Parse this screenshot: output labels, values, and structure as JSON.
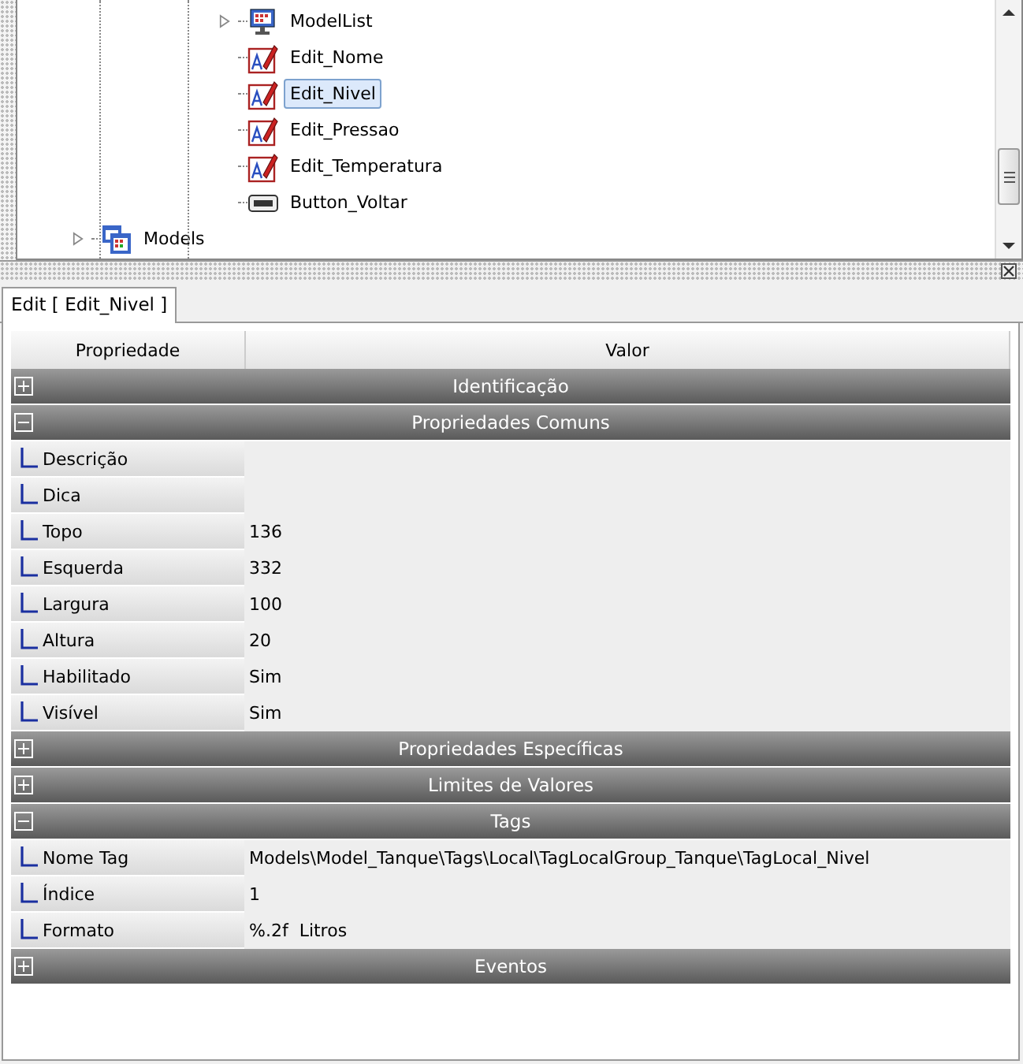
{
  "tree": {
    "items": [
      {
        "label": "ModelList",
        "kind": "list",
        "expandable": true,
        "selected": false
      },
      {
        "label": "Edit_Nome",
        "kind": "edit",
        "expandable": false,
        "selected": false
      },
      {
        "label": "Edit_Nivel",
        "kind": "edit",
        "expandable": false,
        "selected": true
      },
      {
        "label": "Edit_Pressao",
        "kind": "edit",
        "expandable": false,
        "selected": false
      },
      {
        "label": "Edit_Temperatura",
        "kind": "edit",
        "expandable": false,
        "selected": false
      },
      {
        "label": "Button_Voltar",
        "kind": "button",
        "expandable": false,
        "selected": false
      }
    ],
    "outer_items": [
      {
        "label": "Models",
        "kind": "models",
        "expandable": true,
        "selected": false
      }
    ]
  },
  "tab": {
    "label": "Edit [ Edit_Nivel ]"
  },
  "grid": {
    "columns": [
      "Propriedade",
      "Valor"
    ],
    "sections": [
      {
        "title": "Identificação",
        "expanded": false
      },
      {
        "title": "Propriedades Comuns",
        "expanded": true,
        "rows": [
          {
            "name": "Descrição",
            "value": ""
          },
          {
            "name": "Dica",
            "value": ""
          },
          {
            "name": "Topo",
            "value": "136"
          },
          {
            "name": "Esquerda",
            "value": "332"
          },
          {
            "name": "Largura",
            "value": "100"
          },
          {
            "name": "Altura",
            "value": "20"
          },
          {
            "name": "Habilitado",
            "value": "Sim"
          },
          {
            "name": "Visível",
            "value": "Sim"
          }
        ]
      },
      {
        "title": "Propriedades Específicas",
        "expanded": false
      },
      {
        "title": "Limites de Valores",
        "expanded": false
      },
      {
        "title": "Tags",
        "expanded": true,
        "rows": [
          {
            "name": "Nome Tag",
            "value": "Models\\Model_Tanque\\Tags\\Local\\TagLocalGroup_Tanque\\TagLocal_Nivel"
          },
          {
            "name": "Índice",
            "value": "1"
          },
          {
            "name": "Formato",
            "value": "%.2f  Litros"
          }
        ]
      },
      {
        "title": "Eventos",
        "expanded": false
      }
    ]
  }
}
